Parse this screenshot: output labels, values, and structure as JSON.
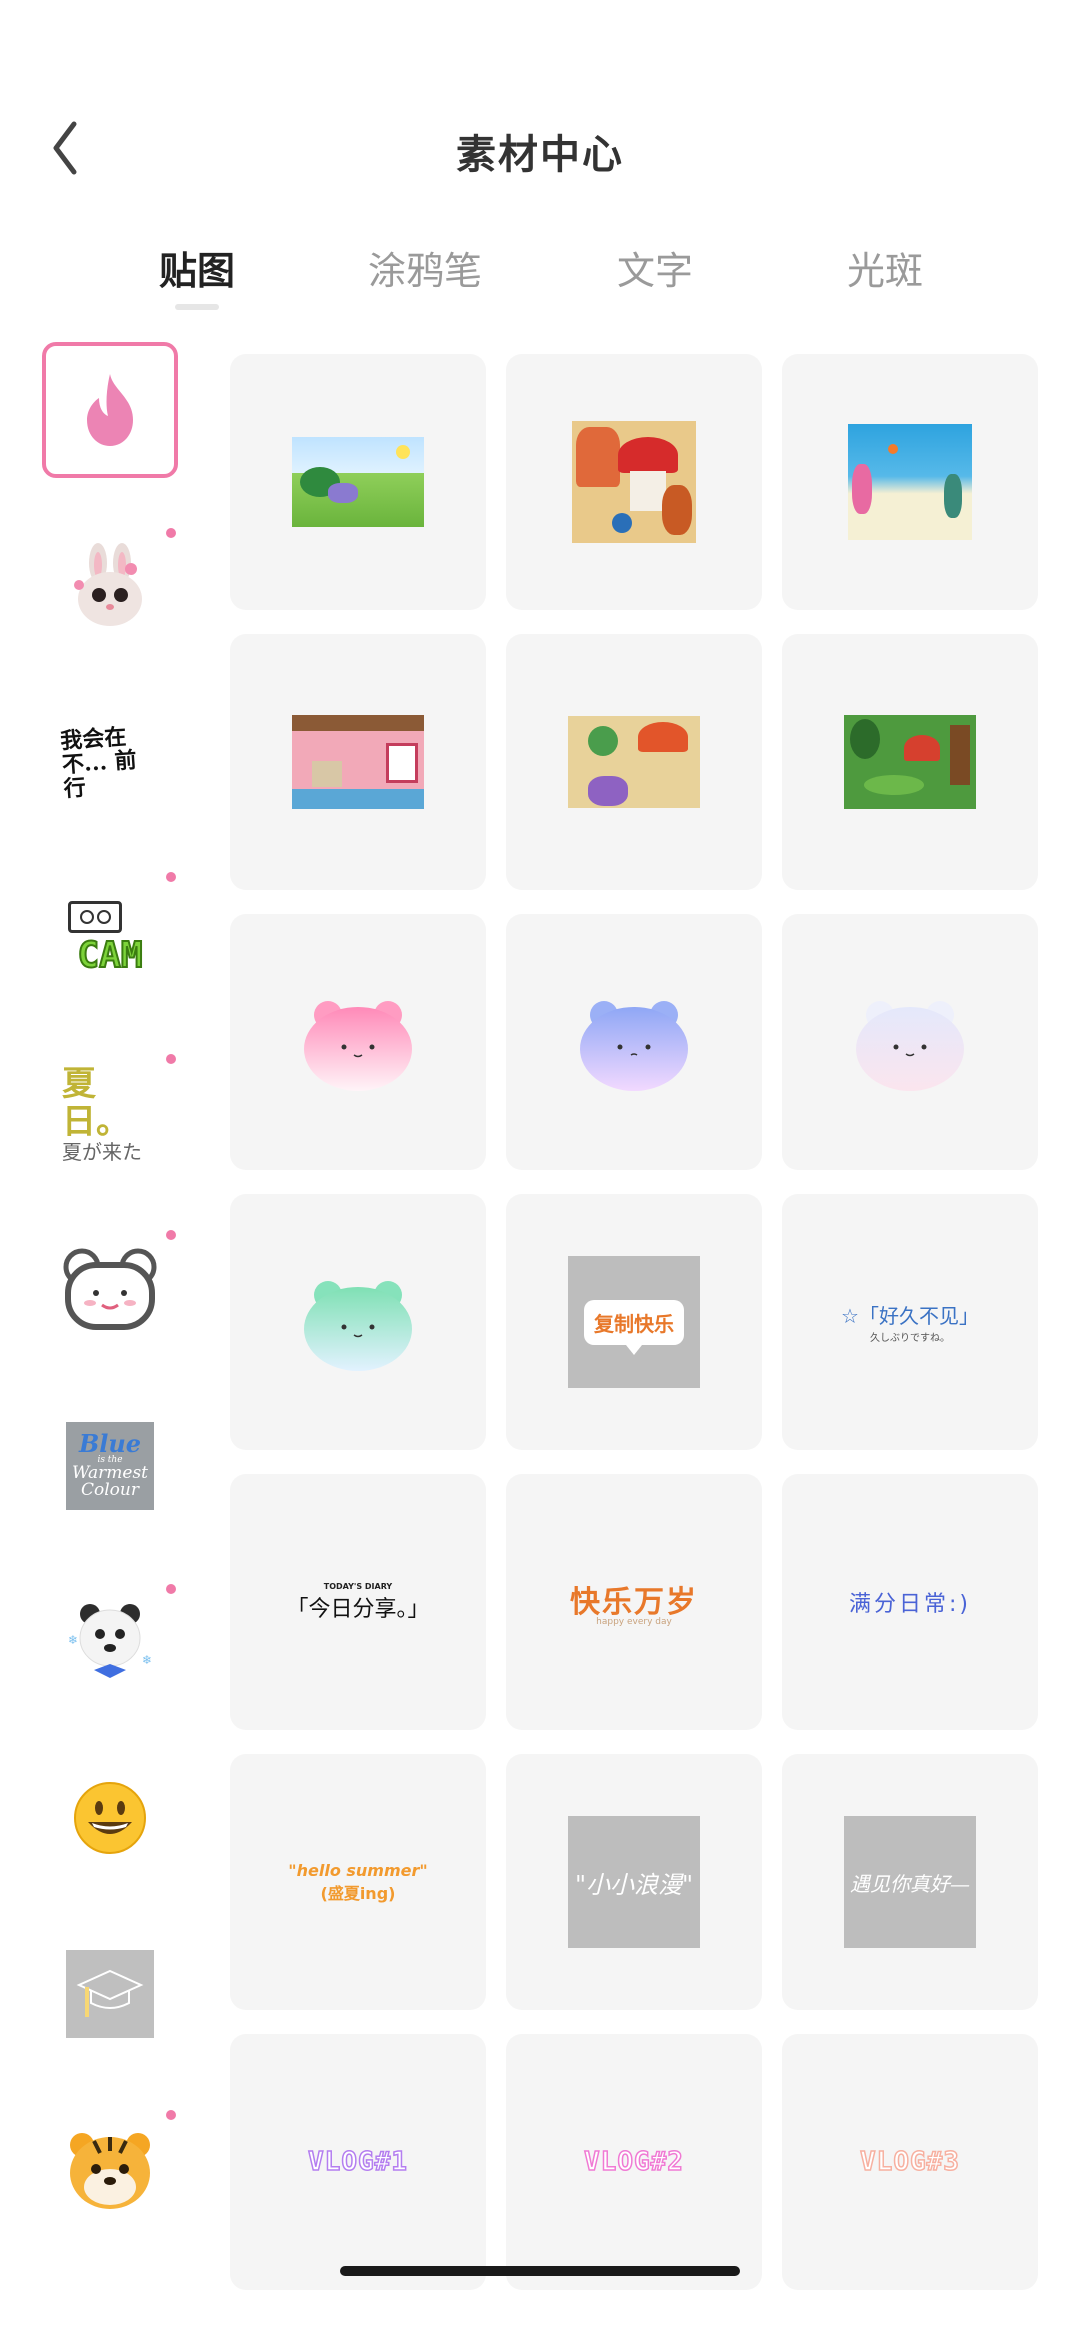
{
  "header": {
    "title": "素材中心"
  },
  "tabs": [
    {
      "label": "贴图",
      "active": true
    },
    {
      "label": "涂鸦笔",
      "active": false
    },
    {
      "label": "文字",
      "active": false
    },
    {
      "label": "光斑",
      "active": false
    }
  ],
  "sidebar": {
    "items": [
      {
        "icon": "flame-icon",
        "selected": true,
        "new_dot": false
      },
      {
        "icon": "bunny-emoji-icon",
        "new_dot": true
      },
      {
        "icon": "handwriting-icon",
        "text": "我会在不... 前行",
        "new_dot": false
      },
      {
        "icon": "cam-icon",
        "text": "CAM",
        "new_dot": true
      },
      {
        "icon": "summer-text-icon",
        "text": "夏日。",
        "subtext": "夏が来た",
        "new_dot": true
      },
      {
        "icon": "bear-face-icon",
        "new_dot": true
      },
      {
        "icon": "blue-warmest-colour-icon",
        "text_lines": [
          "Blue",
          "is the",
          "Warmest",
          "Colour"
        ],
        "new_dot": false
      },
      {
        "icon": "polar-bear-icon",
        "new_dot": true
      },
      {
        "icon": "smile-emoji-icon",
        "new_dot": false
      },
      {
        "icon": "graduation-cap-icon",
        "new_dot": false
      },
      {
        "icon": "tiger-emoji-icon",
        "new_dot": true
      }
    ]
  },
  "stickers": {
    "r4c2": {
      "text": "复制快乐"
    },
    "r4c3": {
      "text": "☆「好久不见」",
      "sub": "久しぶりですね。"
    },
    "r5c1": {
      "top": "TODAY'S DIARY",
      "text": "「今日分享。」"
    },
    "r5c2": {
      "text": "快乐万岁",
      "sub": "happy every day"
    },
    "r5c3": {
      "text": "满分日常:)"
    },
    "r6c1": {
      "text": "\"hello summer\"",
      "sub": "(盛夏ing)"
    },
    "r6c2": {
      "text": "\"小小浪漫\""
    },
    "r6c3": {
      "text": "遇见你真好—"
    },
    "r7c1": {
      "text": "VLOG#1"
    },
    "r7c2": {
      "text": "VLOG#2"
    },
    "r7c3": {
      "text": "VLOG#3"
    }
  },
  "colors": {
    "accent": "#f07aa8",
    "cell_bg": "#f5f5f5"
  }
}
